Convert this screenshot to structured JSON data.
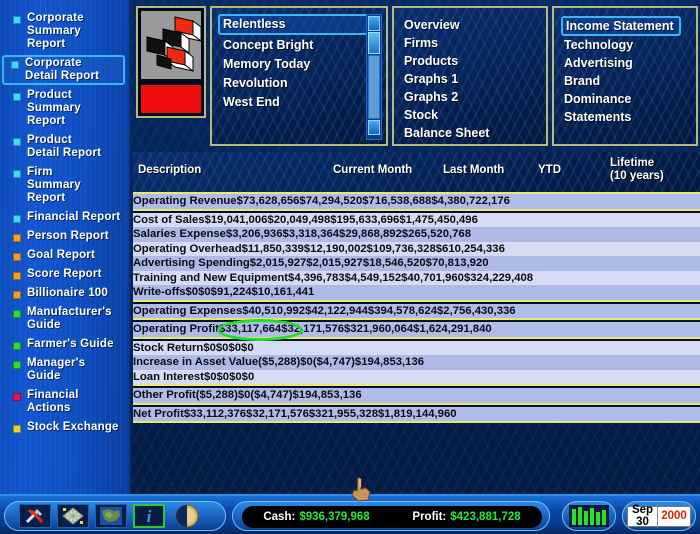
{
  "sidebar": {
    "items": [
      {
        "label": "Corporate\nSummary Report",
        "color": "#3fd8ff",
        "selected": false
      },
      {
        "label": "Corporate\nDetail Report",
        "color": "#3fd8ff",
        "selected": true
      },
      {
        "label": "Product\nSummary Report",
        "color": "#3fd8ff",
        "selected": false
      },
      {
        "label": "Product\nDetail Report",
        "color": "#3fd8ff",
        "selected": false
      },
      {
        "label": "Firm\nSummary Report",
        "color": "#3fd8ff",
        "selected": false
      },
      {
        "label": "Financial Report",
        "color": "#3fd8ff",
        "selected": false
      },
      {
        "label": "Person Report",
        "color": "#f5a11c",
        "selected": false
      },
      {
        "label": "Goal Report",
        "color": "#f5a11c",
        "selected": false
      },
      {
        "label": "Score Report",
        "color": "#f5a11c",
        "selected": false
      },
      {
        "label": "Billionaire 100",
        "color": "#f5a11c",
        "selected": false
      },
      {
        "label": "Manufacturer's\nGuide",
        "color": "#2ddc2d",
        "selected": false
      },
      {
        "label": "Farmer's Guide",
        "color": "#2ddc2d",
        "selected": false
      },
      {
        "label": "Manager's Guide",
        "color": "#2ddc2d",
        "selected": false
      },
      {
        "label": "Financial Actions",
        "color": "#f01050",
        "selected": false
      },
      {
        "label": "Stock Exchange",
        "color": "#f0d020",
        "selected": false
      }
    ]
  },
  "company_list": {
    "items": [
      {
        "label": "Relentless",
        "selected": true
      },
      {
        "label": "Concept Bright",
        "selected": false
      },
      {
        "label": "Memory Today",
        "selected": false
      },
      {
        "label": "Revolution",
        "selected": false
      },
      {
        "label": "West End",
        "selected": false
      }
    ]
  },
  "nav_left": {
    "items": [
      {
        "label": "Overview",
        "selected": false
      },
      {
        "label": "Firms",
        "selected": false
      },
      {
        "label": "Products",
        "selected": false
      },
      {
        "label": "Graphs 1",
        "selected": false
      },
      {
        "label": "Graphs 2",
        "selected": false
      },
      {
        "label": "Stock",
        "selected": false
      },
      {
        "label": "Balance Sheet",
        "selected": false
      }
    ]
  },
  "nav_right": {
    "items": [
      {
        "label": "Income Statement",
        "selected": true
      },
      {
        "label": "Technology",
        "selected": false
      },
      {
        "label": "Advertising",
        "selected": false
      },
      {
        "label": "Brand",
        "selected": false
      },
      {
        "label": "Dominance",
        "selected": false
      },
      {
        "label": "Statements",
        "selected": false
      }
    ]
  },
  "table": {
    "headers": {
      "description": "Description",
      "current_month": "Current Month",
      "last_month": "Last Month",
      "ytd": "YTD",
      "lifetime_line1": "Lifetime",
      "lifetime_line2": "(10 years)"
    },
    "sections": [
      {
        "rows": [
          {
            "label": "Operating Revenue",
            "current": "$73,628,656",
            "last": "$74,294,520",
            "ytd": "$716,538,688",
            "lifetime": "$4,380,722,176"
          }
        ]
      },
      {
        "rows": [
          {
            "label": "Cost of Sales",
            "current": "$19,041,006",
            "last": "$20,049,498",
            "ytd": "$195,633,696",
            "lifetime": "$1,475,450,496"
          },
          {
            "label": "Salaries Expense",
            "current": "$3,206,936",
            "last": "$3,318,364",
            "ytd": "$29,868,892",
            "lifetime": "$265,520,768"
          },
          {
            "label": "Operating Overhead",
            "current": "$11,850,339",
            "last": "$12,190,002",
            "ytd": "$109,736,328",
            "lifetime": "$610,254,336"
          },
          {
            "label": "Advertising Spending",
            "current": "$2,015,927",
            "last": "$2,015,927",
            "ytd": "$18,546,520",
            "lifetime": "$70,813,920"
          },
          {
            "label": "Training and New Equipment",
            "current": "$4,396,783",
            "last": "$4,549,152",
            "ytd": "$40,701,960",
            "lifetime": "$324,229,408"
          },
          {
            "label": "Write-offs",
            "current": "$0",
            "last": "$0",
            "ytd": "$91,224",
            "lifetime": "$10,161,441"
          }
        ]
      },
      {
        "rows": [
          {
            "label": "Operating Expenses",
            "current": "$40,510,992",
            "last": "$42,122,944",
            "ytd": "$394,578,624",
            "lifetime": "$2,756,430,336"
          }
        ]
      },
      {
        "rows": [
          {
            "label": "Operating Profit",
            "current": "$33,117,664",
            "last": "$32,171,576",
            "ytd": "$321,960,064",
            "lifetime": "$1,624,291,840"
          }
        ]
      },
      {
        "rows": [
          {
            "label": "Stock Return",
            "current": "$0",
            "last": "$0",
            "ytd": "$0",
            "lifetime": "$0"
          },
          {
            "label": "Increase in Asset Value",
            "current": "($5,288)",
            "last": "$0",
            "ytd": "($4,747)",
            "lifetime": "$194,853,136"
          },
          {
            "label": "Loan Interest",
            "current": "$0",
            "last": "$0",
            "ytd": "$0",
            "lifetime": "$0"
          }
        ]
      },
      {
        "rows": [
          {
            "label": "Other Profit",
            "current": "($5,288)",
            "last": "$0",
            "ytd": "($4,747)",
            "lifetime": "$194,853,136"
          }
        ]
      },
      {
        "rows": [
          {
            "label": "Net Profit",
            "current": "$33,112,376",
            "last": "$32,171,576",
            "ytd": "$321,955,328",
            "lifetime": "$1,819,144,960"
          }
        ]
      }
    ],
    "highlight": {
      "row": "Operating Profit",
      "column": "Current Month",
      "value": "$33,117,664",
      "color": "#22dd2b"
    }
  },
  "statusbar": {
    "icons": [
      {
        "name": "tools-icon",
        "glyph": "tools"
      },
      {
        "name": "city-grid-icon",
        "glyph": "grid"
      },
      {
        "name": "world-map-icon",
        "glyph": "globe"
      },
      {
        "name": "info-icon",
        "glyph": "i"
      },
      {
        "name": "time-icon",
        "glyph": "moon"
      }
    ],
    "cash_label": "Cash:",
    "cash_value": "$936,379,968",
    "profit_label": "Profit:",
    "profit_value": "$423,881,728",
    "graph_icon": "bar-graph-icon",
    "date_day": "Sep 30",
    "date_year": "2000",
    "cash_color": "#26e83a"
  }
}
